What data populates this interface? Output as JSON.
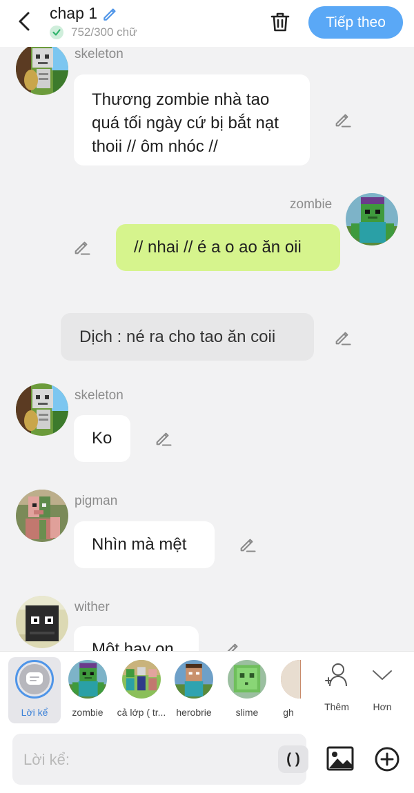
{
  "header": {
    "title": "chap 1",
    "word_count": "752/300 chữ",
    "next_label": "Tiếp theo"
  },
  "colors": {
    "accent": "#5aa8f6",
    "own_bubble": "#d6f48d",
    "check": "#2fb36b"
  },
  "messages": [
    {
      "type": "incoming",
      "sender": "skeleton",
      "avatar": "skeleton",
      "text": "Thương zombie nhà tao quá tối ngày cứ bị bắt nạt thoii // ôm nhóc //"
    },
    {
      "type": "outgoing",
      "sender": "zombie",
      "avatar": "zombie",
      "text": "// nhai // é a o ao ăn oii"
    },
    {
      "type": "narration",
      "text": "Dịch : né ra cho tao ăn coii"
    },
    {
      "type": "incoming",
      "sender": "skeleton",
      "avatar": "skeleton",
      "text": "Ko"
    },
    {
      "type": "incoming",
      "sender": "pigman",
      "avatar": "pigman",
      "text": "Nhìn mà mệt"
    },
    {
      "type": "incoming",
      "sender": "wither",
      "avatar": "wither",
      "text": "Một hay on"
    }
  ],
  "characters": {
    "narrator": "Lời kể",
    "items": [
      {
        "name": "zombie",
        "avatar": "zombie"
      },
      {
        "name": "cả lớp ( tr...",
        "avatar": "class"
      },
      {
        "name": "herobrie",
        "avatar": "herobrine"
      },
      {
        "name": "slime",
        "avatar": "slime"
      },
      {
        "name": "gh",
        "avatar": "ghast"
      }
    ],
    "add_label": "Thêm",
    "more_label": "Hơn"
  },
  "composer": {
    "placeholder": "Lời kể:",
    "paren_label": "( )"
  }
}
